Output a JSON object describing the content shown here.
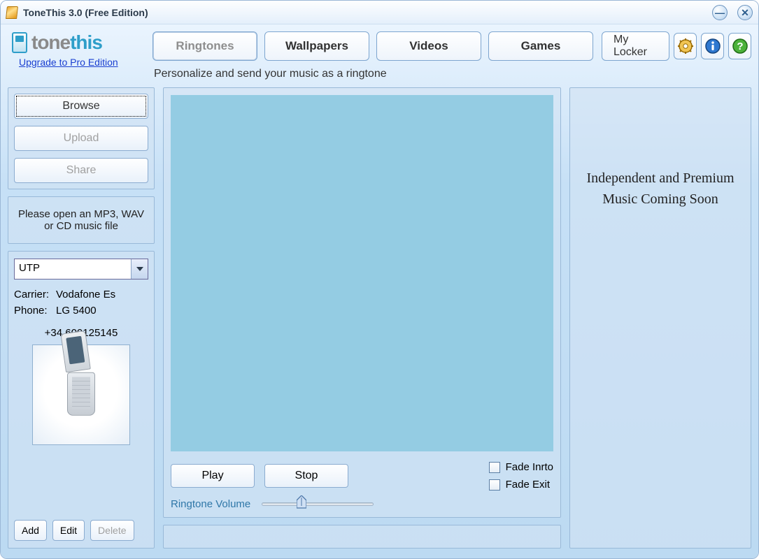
{
  "window": {
    "title": "ToneThis 3.0 (Free Edition)"
  },
  "logo": {
    "brand_1": "tone",
    "brand_2": "this",
    "upgrade_link": "Upgrade to Pro Edition"
  },
  "tabs": {
    "ringtones": "Ringtones",
    "wallpapers": "Wallpapers",
    "videos": "Videos",
    "games": "Games",
    "active": "ringtones"
  },
  "mylocker_label": "My Locker",
  "subtitle": "Personalize and send your music as a ringtone",
  "sidebar": {
    "browse_label": "Browse",
    "upload_label": "Upload",
    "share_label": "Share",
    "hint": "Please open an MP3, WAV or CD music file"
  },
  "profile": {
    "select_value": "UTP",
    "carrier_label": "Carrier:",
    "carrier_value": "Vodafone Es",
    "phone_label": "Phone:",
    "phone_value": "LG 5400",
    "phone_number": "+34 600125145",
    "add_label": "Add",
    "edit_label": "Edit",
    "delete_label": "Delete"
  },
  "player": {
    "play_label": "Play",
    "stop_label": "Stop",
    "volume_label": "Ringtone Volume",
    "fade_in_label": "Fade Inrto",
    "fade_out_label": "Fade Exit",
    "fade_in_checked": false,
    "fade_out_checked": false,
    "volume_percent": 34
  },
  "promo": {
    "text": "Independent and Premium Music Coming Soon"
  }
}
